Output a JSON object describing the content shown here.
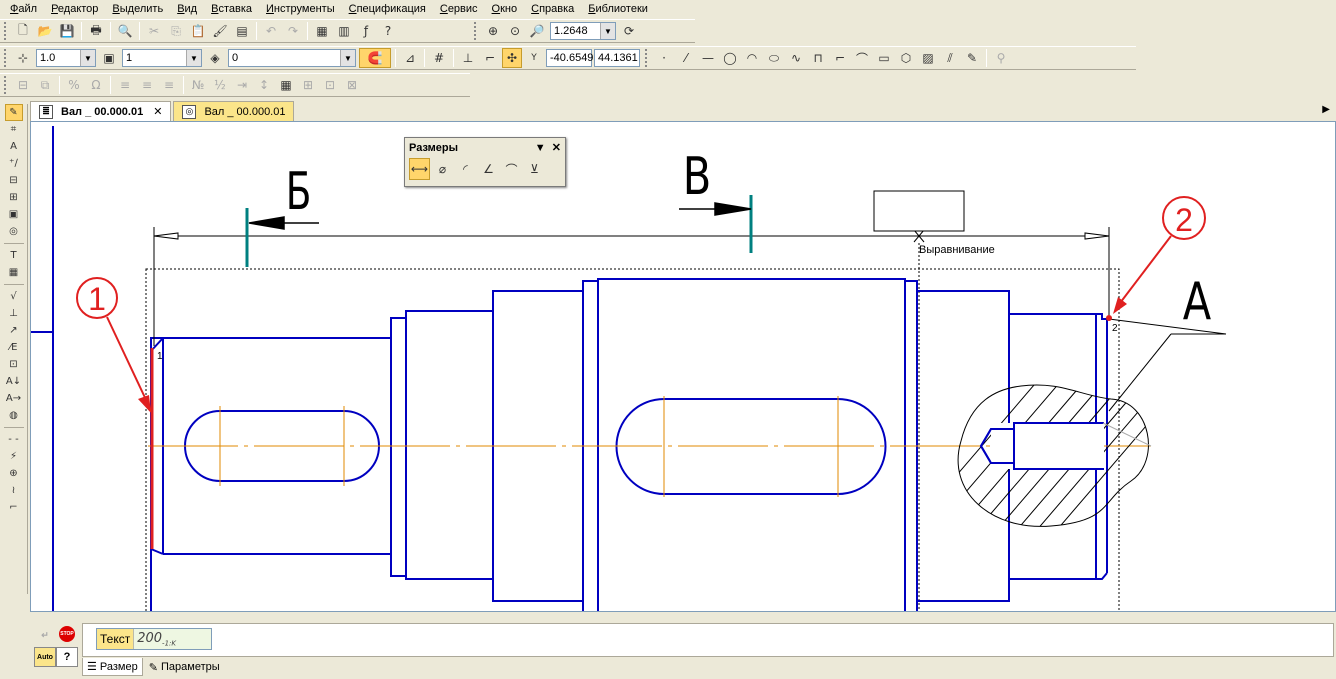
{
  "menu": [
    "Файл",
    "Редактор",
    "Выделить",
    "Вид",
    "Вставка",
    "Инструменты",
    "Спецификация",
    "Сервис",
    "Окно",
    "Справка",
    "Библиотеки"
  ],
  "toolbar_top": {
    "zoom_value": "1.2648"
  },
  "toolbar_current": {
    "step": "1.0",
    "layer": "1",
    "style": "0",
    "coord_x": "-40.6549",
    "coord_y": "44.1361",
    "coord_label": "Y"
  },
  "tabs": [
    {
      "label": "Вал _ 00.000.01",
      "active": true
    },
    {
      "label": "Вал _ 00.000.01",
      "active": false
    }
  ],
  "dims_panel": {
    "title": "Размеры"
  },
  "drawing": {
    "label_b": "Б",
    "label_v": "В",
    "label_a": "А",
    "marker1": "1",
    "marker2": "2",
    "align_label": "Выравнивание",
    "point1": "1",
    "point2": "2"
  },
  "property_bar": {
    "text_label": "Текст",
    "text_value": "200",
    "text_sub": "-1:K",
    "tab_size": "Размер",
    "tab_params": "Параметры"
  },
  "colors": {
    "part": "#0000c0",
    "axis": "#e08a00",
    "annotation": "#e02020",
    "dimension_tick": "#008080"
  }
}
